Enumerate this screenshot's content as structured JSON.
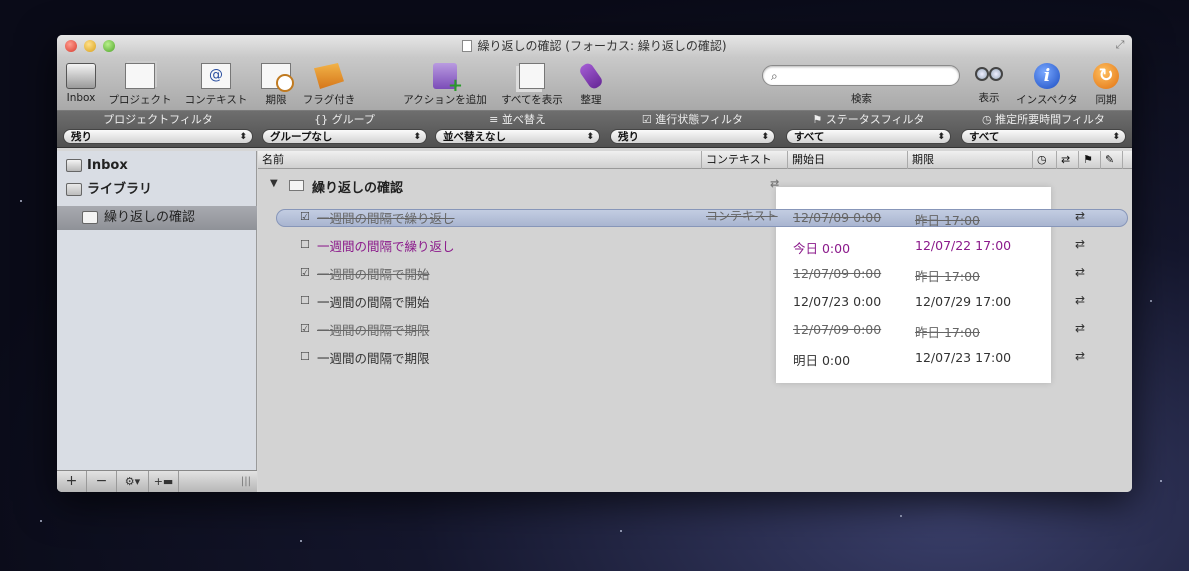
{
  "window": {
    "title": "繰り返しの確認 (フォーカス: 繰り返しの確認)"
  },
  "toolbar": {
    "items": [
      {
        "label": "Inbox",
        "icon": "inbox-icon"
      },
      {
        "label": "プロジェクト",
        "icon": "projects-icon"
      },
      {
        "label": "コンテキスト",
        "icon": "contexts-icon"
      },
      {
        "label": "期限",
        "icon": "due-icon"
      },
      {
        "label": "フラグ付き",
        "icon": "flag-icon"
      },
      {
        "label": "アクションを追加",
        "icon": "add-action-icon"
      },
      {
        "label": "すべてを表示",
        "icon": "show-all-icon"
      },
      {
        "label": "整理",
        "icon": "clean-up-icon"
      }
    ],
    "search_label": "検索",
    "view_label": "表示",
    "inspector_label": "インスペクタ",
    "sync_label": "同期"
  },
  "filters": {
    "project": {
      "title": "プロジェクトフィルタ",
      "value": "残り"
    },
    "group": {
      "title": "{} グループ",
      "value": "グループなし"
    },
    "sort": {
      "title": "並べ替え",
      "value": "並べ替えなし"
    },
    "status": {
      "title": "進行状態フィルタ",
      "value": "残り"
    },
    "flag_status": {
      "title": "ステータスフィルタ",
      "value": "すべて"
    },
    "duration": {
      "title": "推定所要時間フィルタ",
      "value": "すべて"
    }
  },
  "sidebar": {
    "inbox": "Inbox",
    "library": "ライブラリ",
    "project": "繰り返しの確認"
  },
  "columns": {
    "name": "名前",
    "context": "コンテキスト",
    "start": "開始日",
    "due": "期限"
  },
  "project_row": {
    "title": "繰り返しの確認"
  },
  "tasks": [
    {
      "name": "一週間の間隔で繰り返し",
      "context": "コンテキスト",
      "start": "12/07/09 0:00",
      "due": "昨日 17:00",
      "done": true
    },
    {
      "name": "一週間の間隔で繰り返し",
      "context": "",
      "start": "今日 0:00",
      "due": "12/07/22 17:00",
      "done": false
    },
    {
      "name": "一週間の間隔で開始",
      "context": "",
      "start": "12/07/09 0:00",
      "due": "昨日 17:00",
      "done": true
    },
    {
      "name": "一週間の間隔で開始",
      "context": "",
      "start": "12/07/23 0:00",
      "due": "12/07/29 17:00",
      "done": false
    },
    {
      "name": "一週間の間隔で期限",
      "context": "",
      "start": "12/07/09 0:00",
      "due": "昨日 17:00",
      "done": true
    },
    {
      "name": "一週間の間隔で期限",
      "context": "",
      "start": "明日 0:00",
      "due": "12/07/23 17:00",
      "done": false
    }
  ],
  "colors": {
    "accent_purple": "#8b1a8b",
    "selection": "#a9b5d0"
  }
}
